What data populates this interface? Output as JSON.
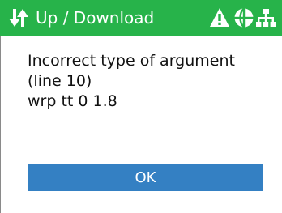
{
  "header": {
    "app_icon": "up-down-arrows-icon",
    "title": "Up / Download",
    "status_icons": [
      "warning-icon",
      "globe-icon",
      "network-icon"
    ]
  },
  "dialog": {
    "message_lines": [
      "Incorrect type of argument",
      "(line 10)",
      "wrp tt 0 1.8"
    ],
    "ok_label": "OK"
  },
  "colors": {
    "header_background": "#27b34a",
    "button_background": "#3480c3",
    "text": "#111111"
  }
}
